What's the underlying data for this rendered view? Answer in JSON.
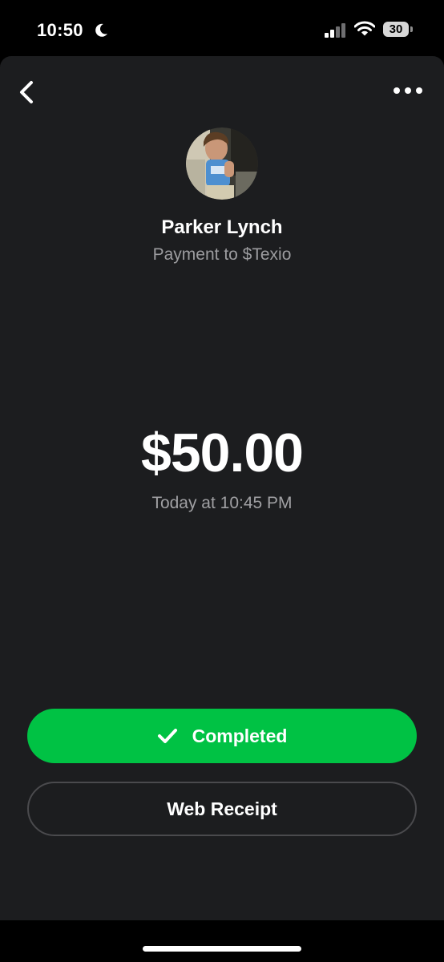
{
  "status_bar": {
    "time": "10:50",
    "battery": "30",
    "icons": [
      "moon-icon",
      "cellular-signal-icon",
      "wifi-icon",
      "battery-icon"
    ]
  },
  "nav": {
    "back_icon": "chevron-left-icon",
    "more_icon": "more-dots-icon"
  },
  "recipient": {
    "name": "Parker Lynch",
    "subtitle": "Payment to $Texio"
  },
  "payment": {
    "amount": "$50.00",
    "date": "Today at 10:45 PM"
  },
  "actions": {
    "completed_label": "Completed",
    "completed_icon": "checkmark-icon",
    "receipt_label": "Web Receipt"
  },
  "colors": {
    "background": "#1c1d1f",
    "accent_green": "#00c244",
    "secondary_text": "#9c9c9f"
  }
}
